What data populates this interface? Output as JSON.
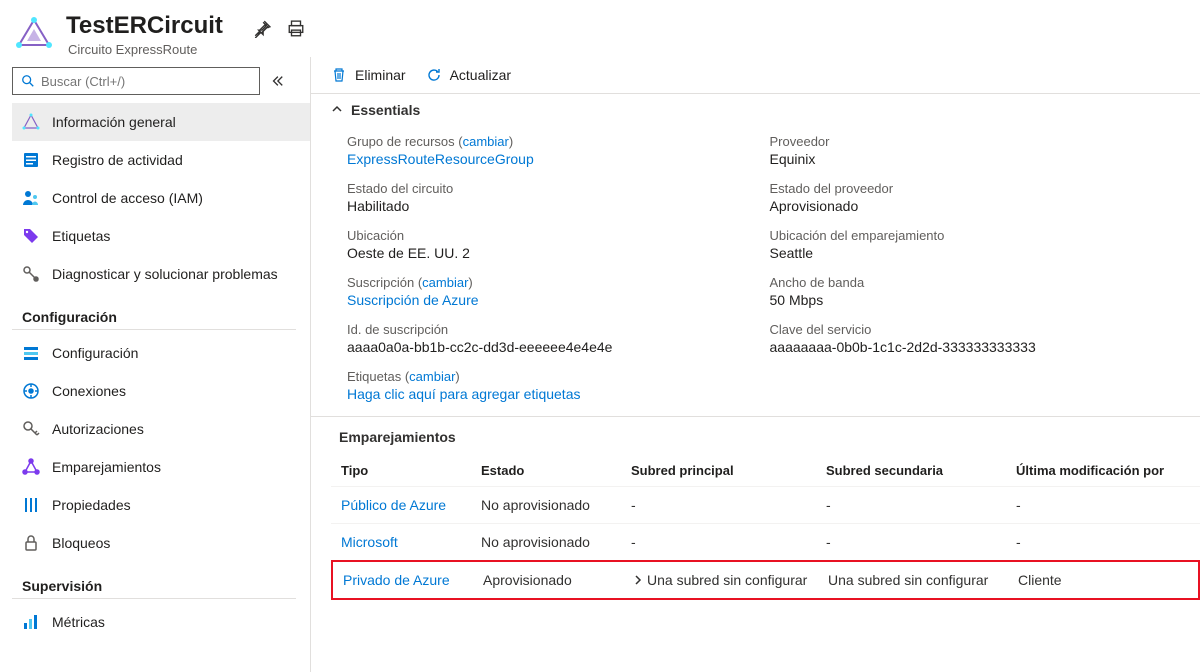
{
  "header": {
    "title": "TestERCircuit",
    "subtitle": "Circuito ExpressRoute"
  },
  "search": {
    "placeholder": "Buscar (Ctrl+/)"
  },
  "nav": {
    "top": [
      {
        "label": "Información general"
      },
      {
        "label": "Registro de actividad"
      },
      {
        "label": "Control de acceso (IAM)"
      },
      {
        "label": "Etiquetas"
      },
      {
        "label": "Diagnosticar y solucionar problemas"
      }
    ],
    "config_header": "Configuración",
    "config": [
      {
        "label": "Configuración"
      },
      {
        "label": "Conexiones"
      },
      {
        "label": "Autorizaciones"
      },
      {
        "label": "Emparejamientos"
      },
      {
        "label": "Propiedades"
      },
      {
        "label": "Bloqueos"
      }
    ],
    "supervision_header": "Supervisión",
    "supervision": [
      {
        "label": "Métricas"
      }
    ]
  },
  "toolbar": {
    "delete": "Eliminar",
    "refresh": "Actualizar"
  },
  "essentials": {
    "header": "Essentials",
    "rg_label": "Grupo de recursos",
    "rg_change": "cambiar",
    "rg_value": "ExpressRouteResourceGroup",
    "provider_label": "Proveedor",
    "provider_value": "Equinix",
    "status_label": "Estado del circuito",
    "status_value": "Habilitado",
    "pstatus_label": "Estado del proveedor",
    "pstatus_value": "Aprovisionado",
    "loc_label": "Ubicación",
    "loc_value": "Oeste de EE. UU. 2",
    "ploc_label": "Ubicación del emparejamiento",
    "ploc_value": "Seattle",
    "sub_label": "Suscripción",
    "sub_change": "cambiar",
    "sub_value": "Suscripción de Azure",
    "bw_label": "Ancho de banda",
    "bw_value": "50 Mbps",
    "subid_label": "Id. de suscripción",
    "subid_value": "aaaa0a0a-bb1b-cc2c-dd3d-eeeeee4e4e4e",
    "skey_label": "Clave del servicio",
    "skey_value": "aaaaaaaa-0b0b-1c1c-2d2d-333333333333",
    "tags_label": "Etiquetas",
    "tags_change": "cambiar",
    "tags_value": "Haga clic aquí para agregar etiquetas"
  },
  "peerings": {
    "header": "Emparejamientos",
    "cols": {
      "tipo": "Tipo",
      "estado": "Estado",
      "sub1": "Subred principal",
      "sub2": "Subred secundaria",
      "mod": "Última modificación por"
    },
    "rows": [
      {
        "tipo": "Público de Azure",
        "estado": "No aprovisionado",
        "sub1": "-",
        "sub2": "-",
        "mod": "-"
      },
      {
        "tipo": "Microsoft",
        "estado": "No aprovisionado",
        "sub1": "-",
        "sub2": "-",
        "mod": "-"
      },
      {
        "tipo": "Privado de Azure",
        "estado": "Aprovisionado",
        "sub1": "Una subred sin configurar",
        "sub2": "Una subred sin configurar",
        "mod": "Cliente"
      }
    ]
  }
}
